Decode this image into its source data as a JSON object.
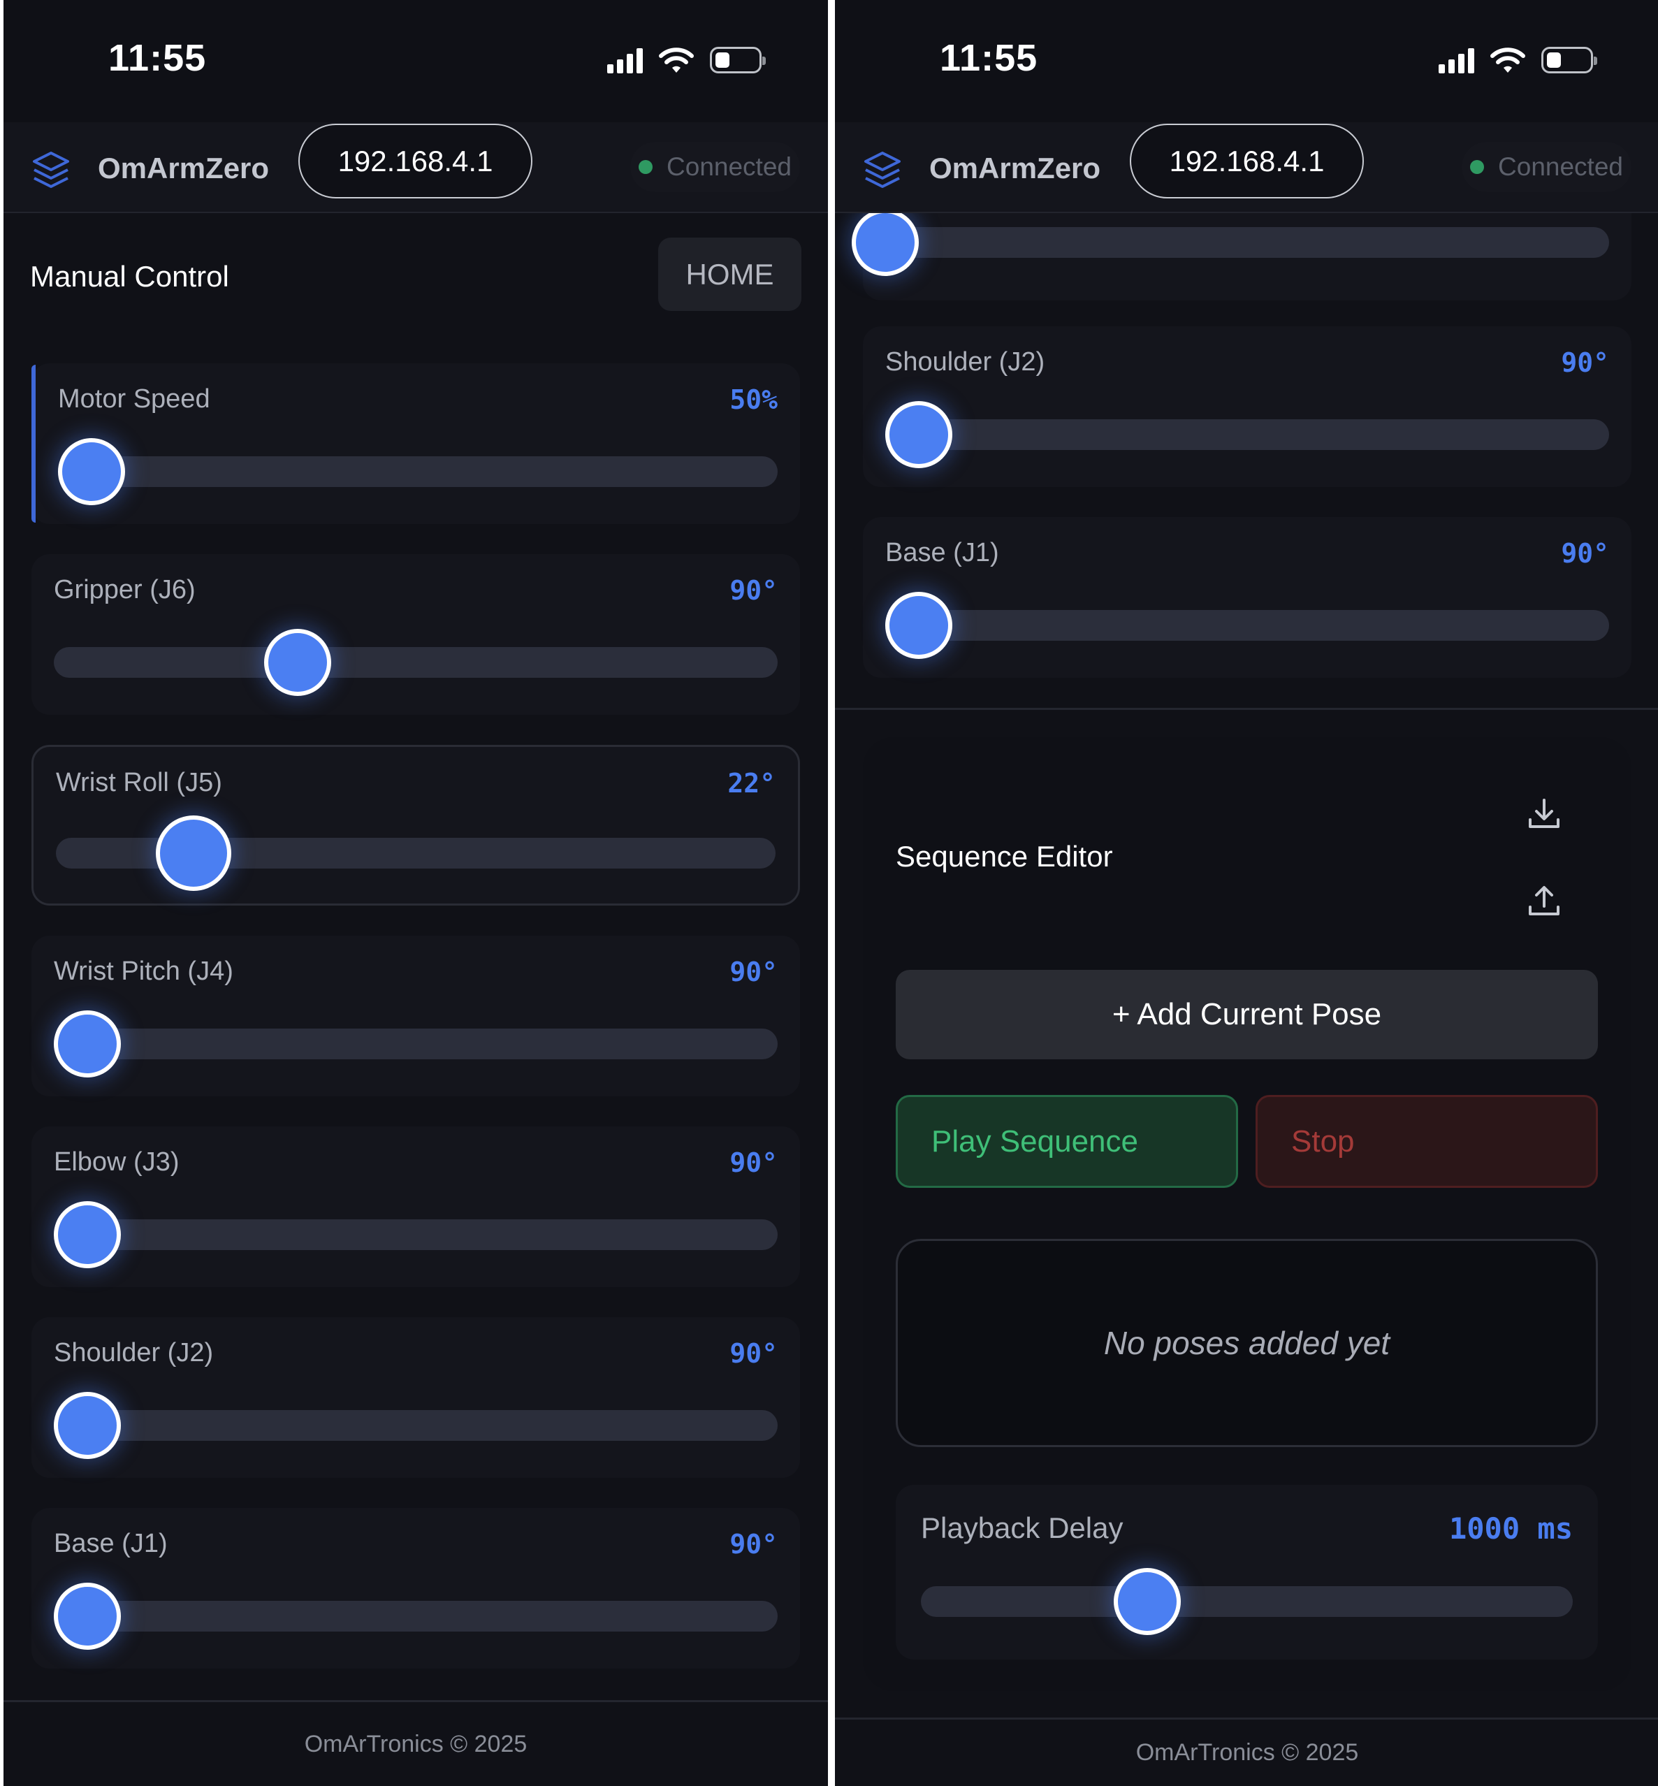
{
  "status_bar": {
    "time": "11:55"
  },
  "header": {
    "app_name": "OmArmZero",
    "ip": "192.168.4.1",
    "connection": "Connected",
    "logo_icon": "layers-icon"
  },
  "manual_control": {
    "title": "Manual Control",
    "home_label": "HOME",
    "sliders": [
      {
        "label": "Motor Speed",
        "value": "50%",
        "level": 0.0
      },
      {
        "label": "Gripper (J6)",
        "value": "90°",
        "level": 0.32
      },
      {
        "label": "Wrist Roll (J5)",
        "value": "22°",
        "level": 0.16
      },
      {
        "label": "Wrist Pitch (J4)",
        "value": "90°",
        "level": 0.0
      },
      {
        "label": "Elbow (J3)",
        "value": "90°",
        "level": 0.0
      },
      {
        "label": "Shoulder (J2)",
        "value": "90°",
        "level": 0.0
      },
      {
        "label": "Base (J1)",
        "value": "90°",
        "level": 0.0
      }
    ]
  },
  "right_sliders": [
    {
      "label": "Shoulder (J2)",
      "value": "90°",
      "level": 0.0
    },
    {
      "label": "Base (J1)",
      "value": "90°",
      "level": 0.0
    }
  ],
  "sequence_editor": {
    "title": "Sequence Editor",
    "download_icon": "download-icon",
    "upload_icon": "upload-icon",
    "add_pose_label": "+ Add Current Pose",
    "play_label": "Play Sequence",
    "stop_label": "Stop",
    "empty_text": "No poses added yet",
    "playback_delay_label": "Playback Delay",
    "playback_delay_value": "1000 ms",
    "playback_delay_level": 0.33
  },
  "footer": {
    "text": "OmArTronics © 2025"
  },
  "colors": {
    "accent": "#4b7ff2",
    "background": "#101117",
    "card": "#14151c",
    "connected": "#2f9a62",
    "play": "#3fbf78",
    "stop": "#a43a38"
  }
}
